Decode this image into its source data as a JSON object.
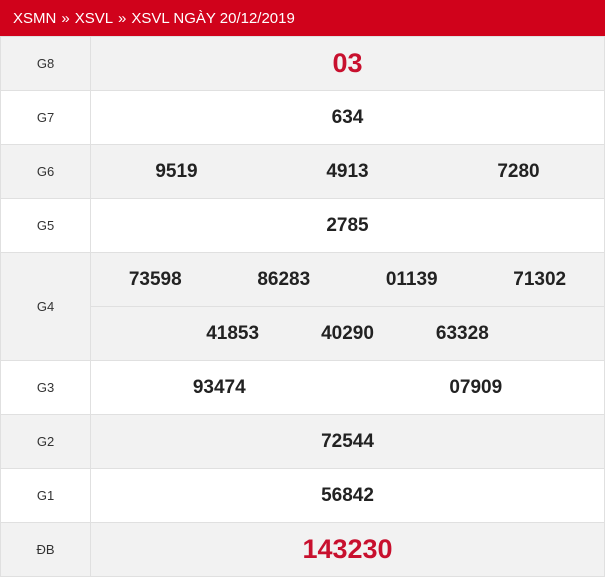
{
  "breadcrumb": {
    "items": [
      "XSMN",
      "XSVL",
      "XSVL NGÀY 20/12/2019"
    ],
    "separator": "»"
  },
  "colors": {
    "brand": "#d0021b",
    "special": "#c8102e",
    "shade": "#f2f2f2"
  },
  "prizes": {
    "g8": {
      "label": "G8",
      "values": [
        "03"
      ]
    },
    "g7": {
      "label": "G7",
      "values": [
        "634"
      ]
    },
    "g6": {
      "label": "G6",
      "values": [
        "9519",
        "4913",
        "7280"
      ]
    },
    "g5": {
      "label": "G5",
      "values": [
        "2785"
      ]
    },
    "g4": {
      "label": "G4",
      "values": [
        "73598",
        "86283",
        "01139",
        "71302",
        "41853",
        "40290",
        "63328"
      ]
    },
    "g3": {
      "label": "G3",
      "values": [
        "93474",
        "07909"
      ]
    },
    "g2": {
      "label": "G2",
      "values": [
        "72544"
      ]
    },
    "g1": {
      "label": "G1",
      "values": [
        "56842"
      ]
    },
    "db": {
      "label": "ĐB",
      "values": [
        "143230"
      ]
    }
  }
}
